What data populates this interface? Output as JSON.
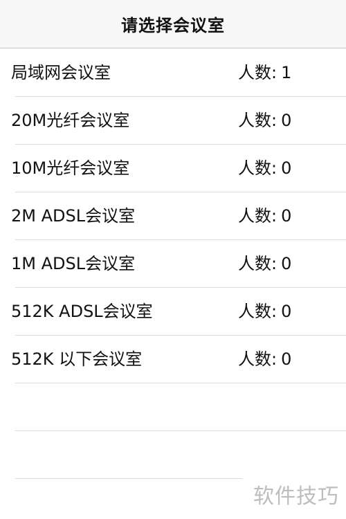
{
  "header": {
    "title": "请选择会议室"
  },
  "rooms": [
    {
      "name": "局域网会议室",
      "count_label": "人数:",
      "count": "1"
    },
    {
      "name": "20M光纤会议室",
      "count_label": "人数:",
      "count": "0"
    },
    {
      "name": "10M光纤会议室",
      "count_label": "人数:",
      "count": "0"
    },
    {
      "name": "2M ADSL会议室",
      "count_label": "人数:",
      "count": "0"
    },
    {
      "name": "1M ADSL会议室",
      "count_label": "人数:",
      "count": "0"
    },
    {
      "name": "512K ADSL会议室",
      "count_label": "人数:",
      "count": "0"
    },
    {
      "name": "512K 以下会议室",
      "count_label": "人数:",
      "count": "0"
    }
  ],
  "watermark": {
    "text": "软件技巧"
  }
}
